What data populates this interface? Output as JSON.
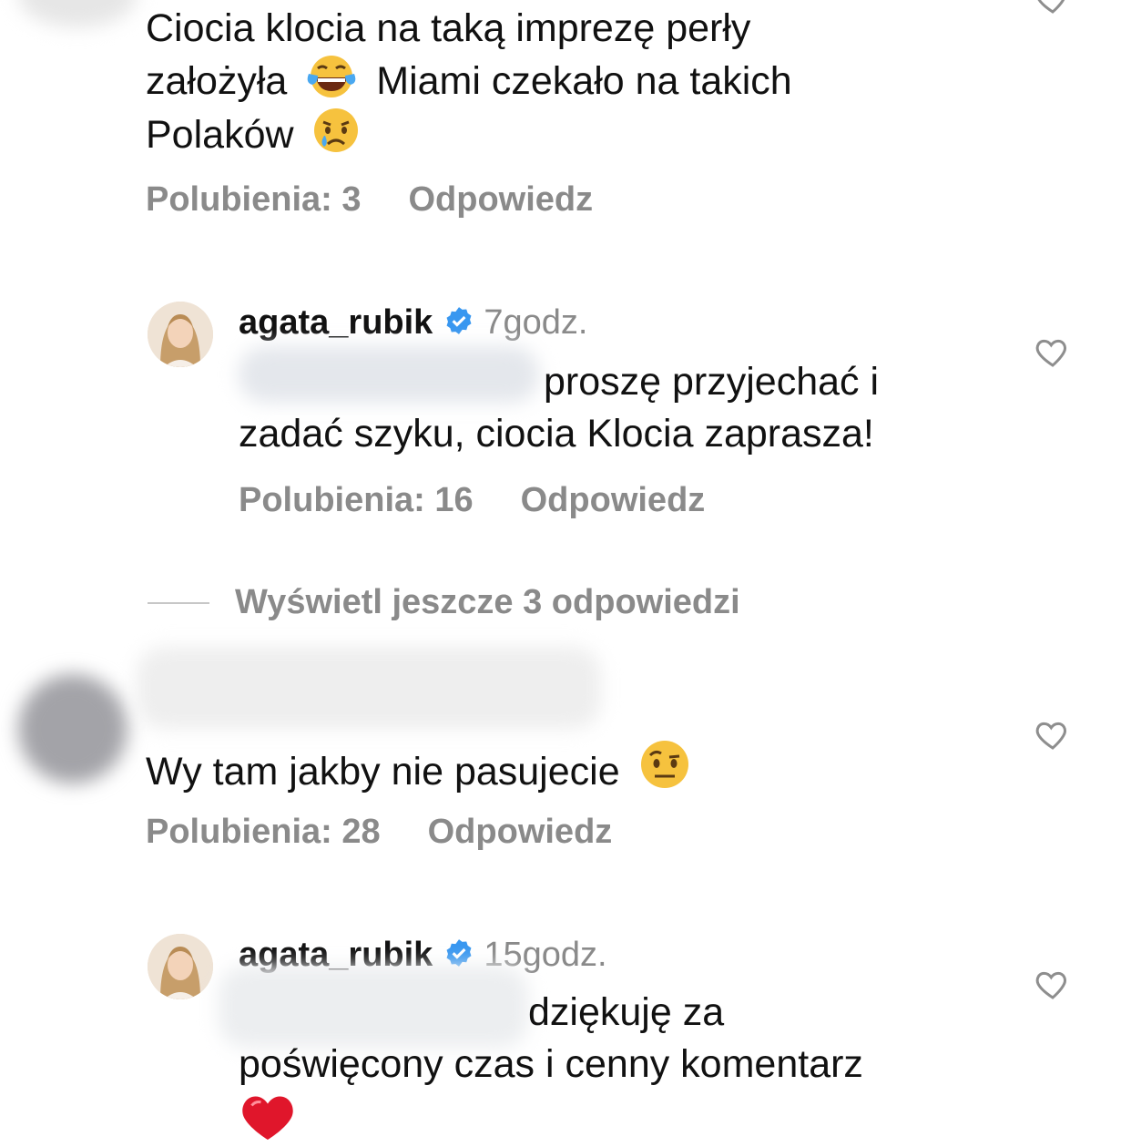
{
  "comments": {
    "c1": {
      "lines": [
        "Ciocia klocia na taką imprezę perły",
        "założyła",
        "Miami czekało na takich",
        "Polaków"
      ],
      "emojis": [
        "face-with-tears-of-joy-icon",
        "crying-face-icon"
      ],
      "likes": "Polubienia: 3",
      "reply": "Odpowiedz"
    },
    "r1": {
      "username": "agata_rubik",
      "time": "7godz.",
      "lines": [
        "proszę przyjechać i",
        "zadać szyku, ciocia Klocia zaprasza!"
      ],
      "likes": "Polubienia: 16",
      "reply": "Odpowiedz"
    },
    "more_replies": "Wyświetl jeszcze 3 odpowiedzi",
    "c2": {
      "text": "Wy tam jakby nie pasujecie",
      "emoji": "face-with-raised-eyebrow-icon",
      "likes": "Polubienia: 28",
      "reply": "Odpowiedz"
    },
    "r2": {
      "username": "agata_rubik",
      "time": "15godz.",
      "lines": [
        "dziękuję za",
        "poświęcony czas i cenny komentarz"
      ],
      "emoji": "red-heart-icon",
      "likes": "",
      "reply": ""
    }
  },
  "colors": {
    "text": "#111111",
    "meta": "#8a8a8a",
    "verified": "#3897f0",
    "heart": "#8e8e8e"
  }
}
